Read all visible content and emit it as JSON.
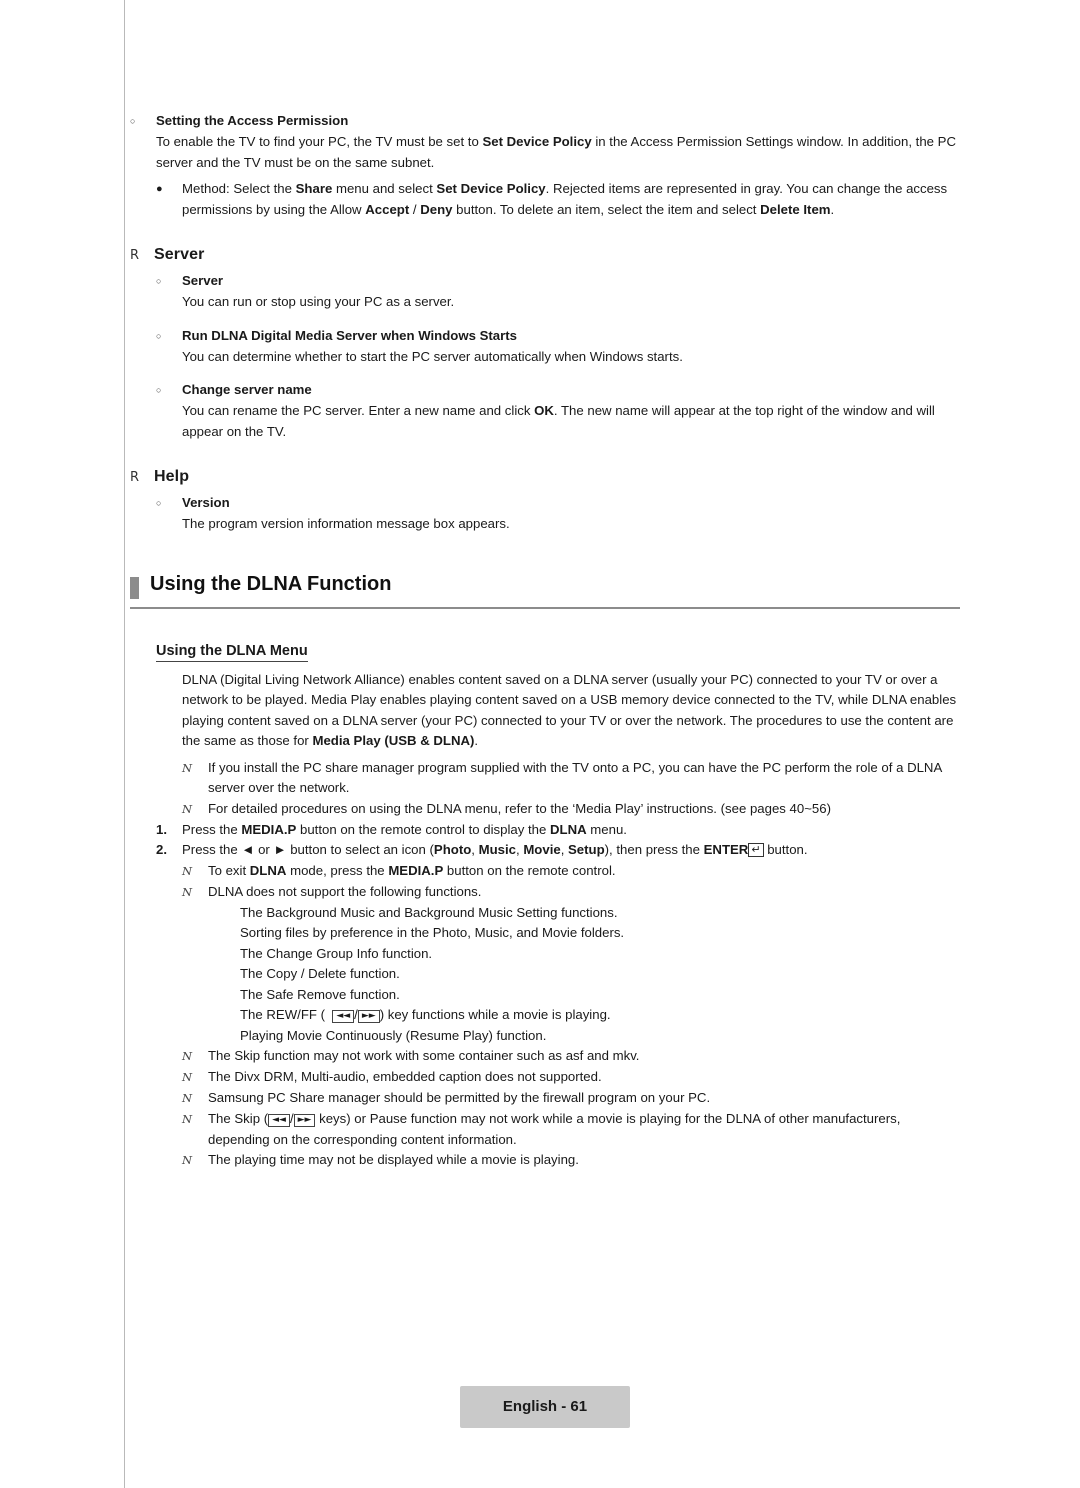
{
  "page": {
    "footer_label": "English - 61"
  },
  "section_access": {
    "heading": "Setting the Access Permission",
    "para_1_a": "To enable the TV to find your PC, the TV must be set to ",
    "para_1_b": "Set Device Policy",
    "para_1_c": " in the Access Permission Settings window. In addition, the PC server and the TV must be on the same subnet.",
    "method_a": "Method: Select the ",
    "method_b": "Share",
    "method_c": " menu and select ",
    "method_d": "Set Device Policy",
    "method_e": ". Rejected items are represented in gray. You can change the access permissions by using the Allow ",
    "method_f": "Accept",
    "method_g": " / ",
    "method_h": "Deny",
    "method_i": " button. To delete an item, select the item and select ",
    "method_j": "Delete Item",
    "method_k": "."
  },
  "section_server": {
    "r_label": "Server",
    "item1_heading": "Server",
    "item1_text": "You can run or stop using your PC as a server.",
    "item2_heading": "Run DLNA Digital Media Server when Windows Starts",
    "item2_text": "You can determine whether to start the PC server automatically when Windows starts.",
    "item3_heading": "Change server name",
    "item3_a": "You can rename the PC server. Enter a new name and click ",
    "item3_b": "OK",
    "item3_c": ". The new name will appear at the top right of the window and will appear on the TV."
  },
  "section_help": {
    "r_label": "Help",
    "item1_heading": "Version",
    "item1_text": "The program version information message box appears."
  },
  "dlna": {
    "banner_title": "Using the DLNA Function",
    "subhead": "Using the DLNA Menu",
    "intro_a": "DLNA (Digital Living Network Alliance) enables content saved on a DLNA server (usually your PC) connected to your TV or over a network to be played. Media Play enables playing content saved on a USB memory device connected to the TV, while DLNA enables playing content saved on a DLNA server (your PC) connected to your TV or over the network. The procedures to use the content are the same as those for ",
    "intro_b": "Media Play (USB & DLNA)",
    "intro_c": ".",
    "note_1": "If you install the PC share manager program supplied with the TV onto a PC, you can have the PC perform the role of a DLNA server over the network.",
    "note_2": "For detailed procedures on using the DLNA menu, refer to the ‘Media Play’ instructions. (see pages 40~56)",
    "step_1_num": "1.",
    "step_1_a": "Press the ",
    "step_1_b": "MEDIA.P",
    "step_1_c": " button on the remote control to display the ",
    "step_1_d": "DLNA",
    "step_1_e": " menu.",
    "step_2_num": "2.",
    "step_2_a": "Press the ",
    "step_2_arrow_left": "◄",
    "step_2_b": " or ",
    "step_2_arrow_right": "►",
    "step_2_c": " button to select an icon (",
    "step_2_photo": "Photo",
    "step_2_sep1": ", ",
    "step_2_music": "Music",
    "step_2_sep2": ", ",
    "step_2_movie": "Movie",
    "step_2_sep3": ", ",
    "step_2_setup": "Setup",
    "step_2_d": "), then press the ",
    "step_2_enter": "ENTER",
    "step_2_enter_glyph": "↵",
    "step_2_e": " button.",
    "note_3_a": "To exit ",
    "note_3_b": "DLNA",
    "note_3_c": " mode, press the ",
    "note_3_d": "MEDIA.P",
    "note_3_e": " button on the remote control.",
    "note_4": "DLNA does not support the following functions.",
    "sub_list": [
      "The Background Music and Background Music Setting functions.",
      "Sorting files by preference in the Photo, Music, and Movie folders.",
      "The Change Group Info function.",
      "The Copy / Delete function.",
      "The Safe Remove function."
    ],
    "rewff_a": "The REW/FF (",
    "rewff_glyph_1": "◄◄",
    "rewff_mid": "/",
    "rewff_glyph_2": "►►",
    "rewff_b": ") key functions while a movie is playing.",
    "resume_play": "Playing Movie Continuously (Resume Play) function.",
    "note_5": "The Skip function may not work with some container such as asf and mkv.",
    "note_6": "The Divx DRM, Multi-audio, embedded caption does not supported.",
    "note_7": "Samsung PC Share manager should be permitted by the firewall program on your PC.",
    "note_8_a": "The Skip (",
    "note_8_glyph_1": "◄◄",
    "note_8_mid": "/",
    "note_8_glyph_2": "►►",
    "note_8_b": " keys) or Pause function may not work while a movie is playing for the DLNA of other manufacturers, depending on the corresponding content information.",
    "note_9": "The playing time may not be displayed while a movie is playing."
  },
  "glyphs": {
    "circle": "○",
    "dot": "●",
    "note": "N",
    "r": "R"
  }
}
